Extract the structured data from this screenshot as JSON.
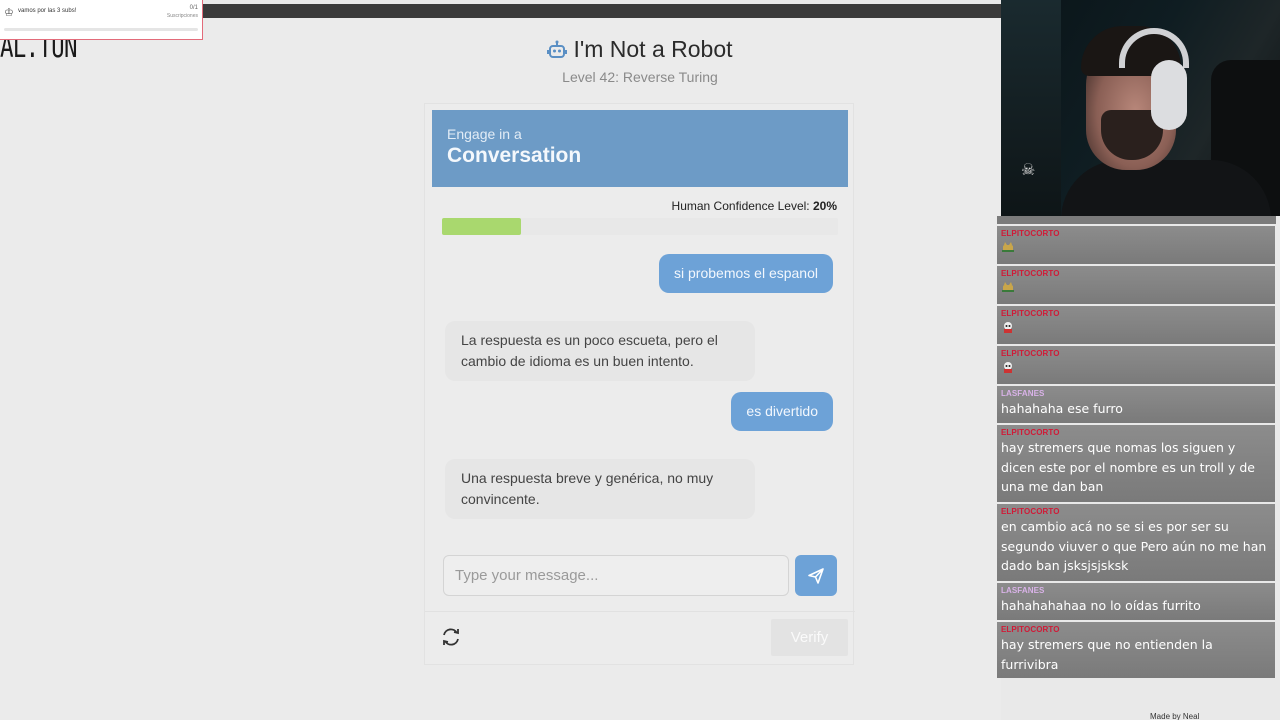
{
  "overlay": {
    "sub_goal_text": "vamos por las 3 subs!",
    "sub_goal_count": "0/1",
    "sub_goal_label": "Suscripciones"
  },
  "page": {
    "logo_text": "AL.TUN",
    "title": "I'm Not a Robot",
    "subtitle": "Level 42: Reverse Turing",
    "bottom_left": "",
    "bottom_right": "Made by Neal"
  },
  "card": {
    "eyebrow": "Engage in a",
    "heading": "Conversation",
    "confidence_label": "Human Confidence Level:",
    "confidence_value": "20%",
    "confidence_fraction": 0.2,
    "messages": [
      {
        "role": "user",
        "text": "si probemos el espanol"
      },
      {
        "role": "bot",
        "text": "La respuesta es un poco escueta, pero el cambio de idioma es un buen intento."
      },
      {
        "role": "user",
        "text": "es divertido"
      },
      {
        "role": "bot",
        "text": "Una respuesta breve y genérica, no muy convincente."
      }
    ],
    "input_placeholder": "Type your message...",
    "verify_label": "Verify"
  },
  "chat": {
    "messages": [
      {
        "user": "ELPITOCORTO",
        "text": "",
        "emote": "cat-emote",
        "color": "#d01a37"
      },
      {
        "user": "ELPITOCORTO",
        "text": "",
        "emote": "cat-emote",
        "color": "#d01a37"
      },
      {
        "user": "ELPITOCORTO",
        "text": "",
        "emote": "skull-emote",
        "color": "#d01a37"
      },
      {
        "user": "ELPITOCORTO",
        "text": "",
        "emote": "skull-emote",
        "color": "#d01a37"
      },
      {
        "user": "LASFANES",
        "text": "hahahaha ese furro",
        "color": "#d9b2e8"
      },
      {
        "user": "ELPITOCORTO",
        "text": "hay stremers que nomas los siguen y dicen este por el nombre es un troll y de una me dan ban",
        "color": "#d01a37"
      },
      {
        "user": "ELPITOCORTO",
        "text": "en cambio acá no se si es por ser su segundo viuver o que Pero aún no me han dado ban jsksjsjsksk",
        "color": "#d01a37"
      },
      {
        "user": "LASFANES",
        "text": "hahahahahaa no lo oídas furrito",
        "color": "#d9b2e8"
      },
      {
        "user": "ELPITOCORTO",
        "text": "hay stremers que no entienden la furrivibra",
        "color": "#d01a37"
      }
    ]
  }
}
